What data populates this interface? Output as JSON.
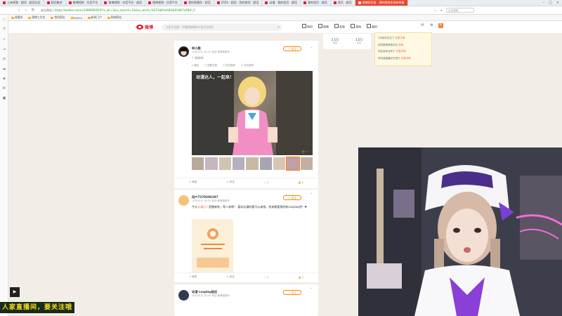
{
  "tabs": [
    {
      "label": "土味视频 · 超话 · 超话社区"
    },
    {
      "label": "超话聚合"
    },
    {
      "label": "微博视频 · 抖音平台"
    },
    {
      "label": "微博视频 · 抖音平台 · 超话"
    },
    {
      "label": "微博视频 · 抖音平台"
    },
    {
      "label": "我的直播间 · 超话"
    },
    {
      "label": "2024 · 超话 · 我的首页 · 超话"
    },
    {
      "label": "动漫 · 我的首页 · 超话"
    },
    {
      "label": "我的首页 · 超话"
    },
    {
      "label": "首页 · 超话"
    },
    {
      "label": "微博网页版 · 随时随地发现新鲜事",
      "active": true
    }
  ],
  "address": {
    "secure_label": "安全网站",
    "url": "https://weibo.com/u/1989660919?is_all=1&is_search=1&key_word=%E5%8A%A8%E6%BC%AB#_0",
    "search_placeholder": "点击搜索"
  },
  "bookmarks": [
    "收藏夹",
    "微博工作台",
    "常用网址",
    "bilibili",
    "新闻门户",
    "购物网站"
  ],
  "navbar": {
    "logo_text": "微博",
    "search_placeholder": "大家正在搜：中国网络视听大会正在进行",
    "nav": [
      "首页",
      "视频",
      "发现",
      "游戏",
      "我的"
    ]
  },
  "posts": [
    {
      "name": "林小鹿",
      "meta": "10月15日 18:41 来自 微博视频号",
      "follow": "+ 关注",
      "text": "！😊😊😊",
      "video_caption": "动漫达人，一起来！",
      "actions": [
        "转发",
        "评论",
        "1",
        "1"
      ]
    },
    {
      "name": "用户7378306197",
      "meta": "10月15日 18:35 来自 微博视频号",
      "follow": "+ 关注",
      "text_prefix": "今天",
      "text_hl": "动漫达人",
      "text_rest": "直播来啦，等人来啊！ 喜欢动漫的都可以来哦，快来看看我的新cosplay吧！❤",
      "actions": [
        "转发",
        "评论",
        "1",
        "1"
      ]
    },
    {
      "name": "动漫·cosplay超话",
      "meta": "10月15日 18:40 来自 微博视频号",
      "follow": "+ 关注"
    }
  ],
  "stats": [
    {
      "value": "2.1万",
      "label": "粉丝"
    },
    {
      "value": "1.2万",
      "label": "关注"
    }
  ],
  "notice": [
    {
      "text": "1天前你关注了",
      "link": "查看详情"
    },
    {
      "text": "你的微博有新评论",
      "link": "查看"
    },
    {
      "text": "好友给你点赞了",
      "link": "查看详情"
    },
    {
      "text": "有动漫直播正在进行",
      "link": "查看详情"
    }
  ],
  "overlay_text": "人家直播间，要关注哦",
  "colors": {
    "weibo_red": "#e6162d",
    "accent_orange": "#ff8200",
    "tab_active": "#e8452f"
  }
}
